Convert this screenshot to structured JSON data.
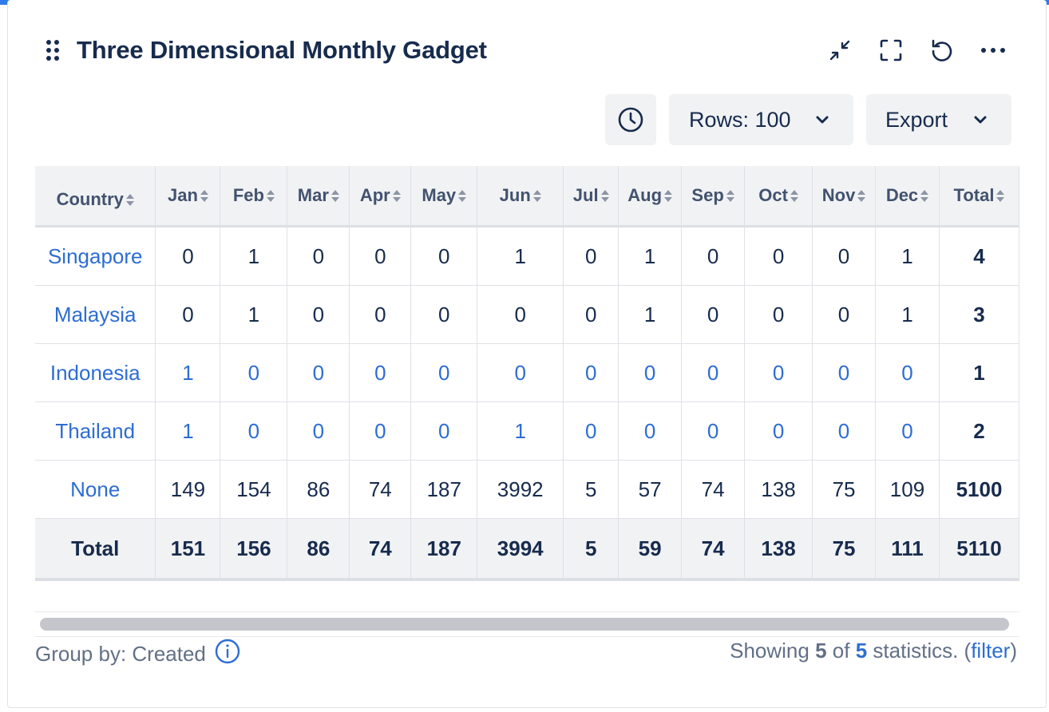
{
  "gadget": {
    "title": "Three Dimensional Monthly Gadget",
    "header_icons": [
      "minimize-icon",
      "fullscreen-icon",
      "refresh-icon",
      "more-icon"
    ]
  },
  "toolbar": {
    "history_icon": "clock-icon",
    "rows_label": "Rows: 100",
    "export_label": "Export"
  },
  "table": {
    "columns": [
      "Country",
      "Jan",
      "Feb",
      "Mar",
      "Apr",
      "May",
      "Jun",
      "Jul",
      "Aug",
      "Sep",
      "Oct",
      "Nov",
      "Dec",
      "Total"
    ],
    "rows": [
      {
        "country": "Singapore",
        "values": [
          "0",
          "1",
          "0",
          "0",
          "0",
          "1",
          "0",
          "1",
          "0",
          "0",
          "0",
          "1"
        ],
        "total": "4",
        "linked": false
      },
      {
        "country": "Malaysia",
        "values": [
          "0",
          "1",
          "0",
          "0",
          "0",
          "0",
          "0",
          "1",
          "0",
          "0",
          "0",
          "1"
        ],
        "total": "3",
        "linked": false
      },
      {
        "country": "Indonesia",
        "values": [
          "1",
          "0",
          "0",
          "0",
          "0",
          "0",
          "0",
          "0",
          "0",
          "0",
          "0",
          "0"
        ],
        "total": "1",
        "linked": true
      },
      {
        "country": "Thailand",
        "values": [
          "1",
          "0",
          "0",
          "0",
          "0",
          "1",
          "0",
          "0",
          "0",
          "0",
          "0",
          "0"
        ],
        "total": "2",
        "linked": true
      },
      {
        "country": "None",
        "values": [
          "149",
          "154",
          "86",
          "74",
          "187",
          "3992",
          "5",
          "57",
          "74",
          "138",
          "75",
          "109"
        ],
        "total": "5100",
        "linked": false
      }
    ],
    "total_row": {
      "label": "Total",
      "values": [
        "151",
        "156",
        "86",
        "74",
        "187",
        "3994",
        "5",
        "59",
        "74",
        "138",
        "75",
        "111"
      ],
      "total": "5110"
    }
  },
  "footer": {
    "group_by": "Group by: Created",
    "info_icon": "info-icon",
    "showing_prefix": "Showing",
    "shown_count": "5",
    "of_text": "of",
    "total_count": "5",
    "suffix": "statistics. (",
    "filter_label": "filter",
    "close_paren": ")"
  },
  "colors": {
    "accent": "#2f7bea",
    "link": "#2d6dd2",
    "header_bg": "#f1f2f4"
  }
}
